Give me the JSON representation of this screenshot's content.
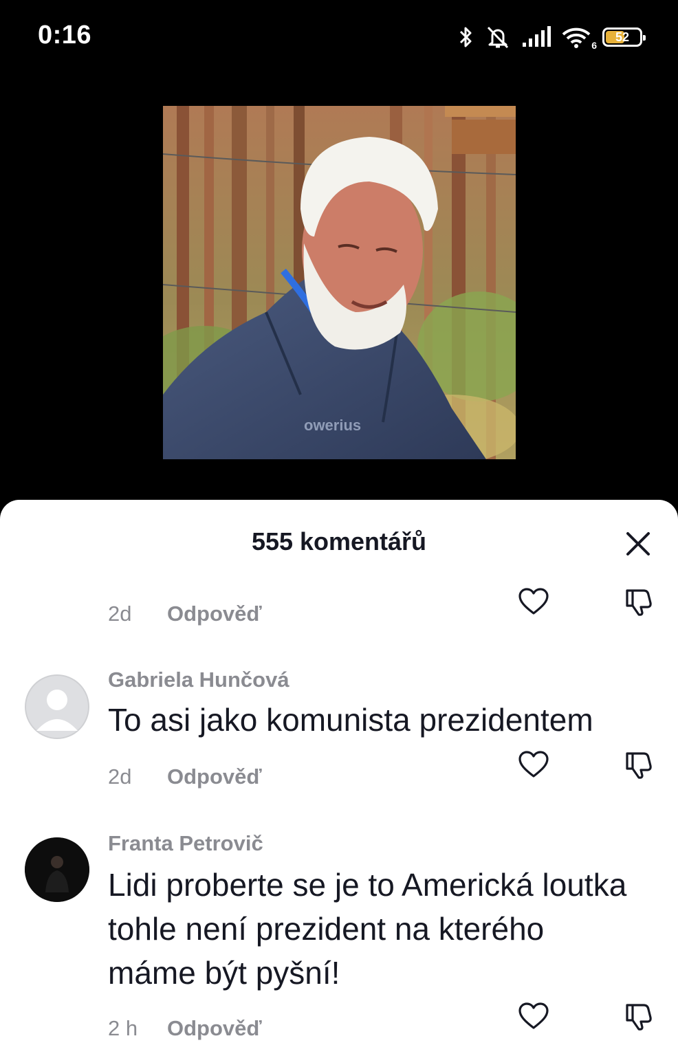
{
  "status_bar": {
    "time": "0:16",
    "icons": [
      "bluetooth-icon",
      "mute-icon",
      "signal-icon",
      "wifi-icon",
      "battery-icon"
    ],
    "wifi_badge": "6",
    "battery_level": "52",
    "battery_color": "#e8b23a"
  },
  "video": {
    "thumbnail": "person-photo",
    "watermark": "owerius"
  },
  "comments_sheet": {
    "title": "555 komentářů",
    "close_icon": "close-icon",
    "partial_comment": {
      "time": "2d",
      "reply_label": "Odpověď"
    },
    "comments": [
      {
        "username": "Gabriela Hunčová",
        "avatar": "default-avatar",
        "text": "To asi jako komunista prezidentem",
        "time": "2d",
        "reply_label": "Odpověď"
      },
      {
        "username": "Franta Petrovič",
        "avatar": "dark-avatar",
        "text": "Lidi proberte se je to Americká loutka tohle není prezident na kterého máme být pyšní!",
        "time": "2 h",
        "reply_label": "Odpověď"
      }
    ]
  },
  "colors": {
    "background_top": "#000000",
    "sheet": "#ffffff",
    "text_primary": "#161823",
    "text_secondary": "#8a8b91"
  }
}
